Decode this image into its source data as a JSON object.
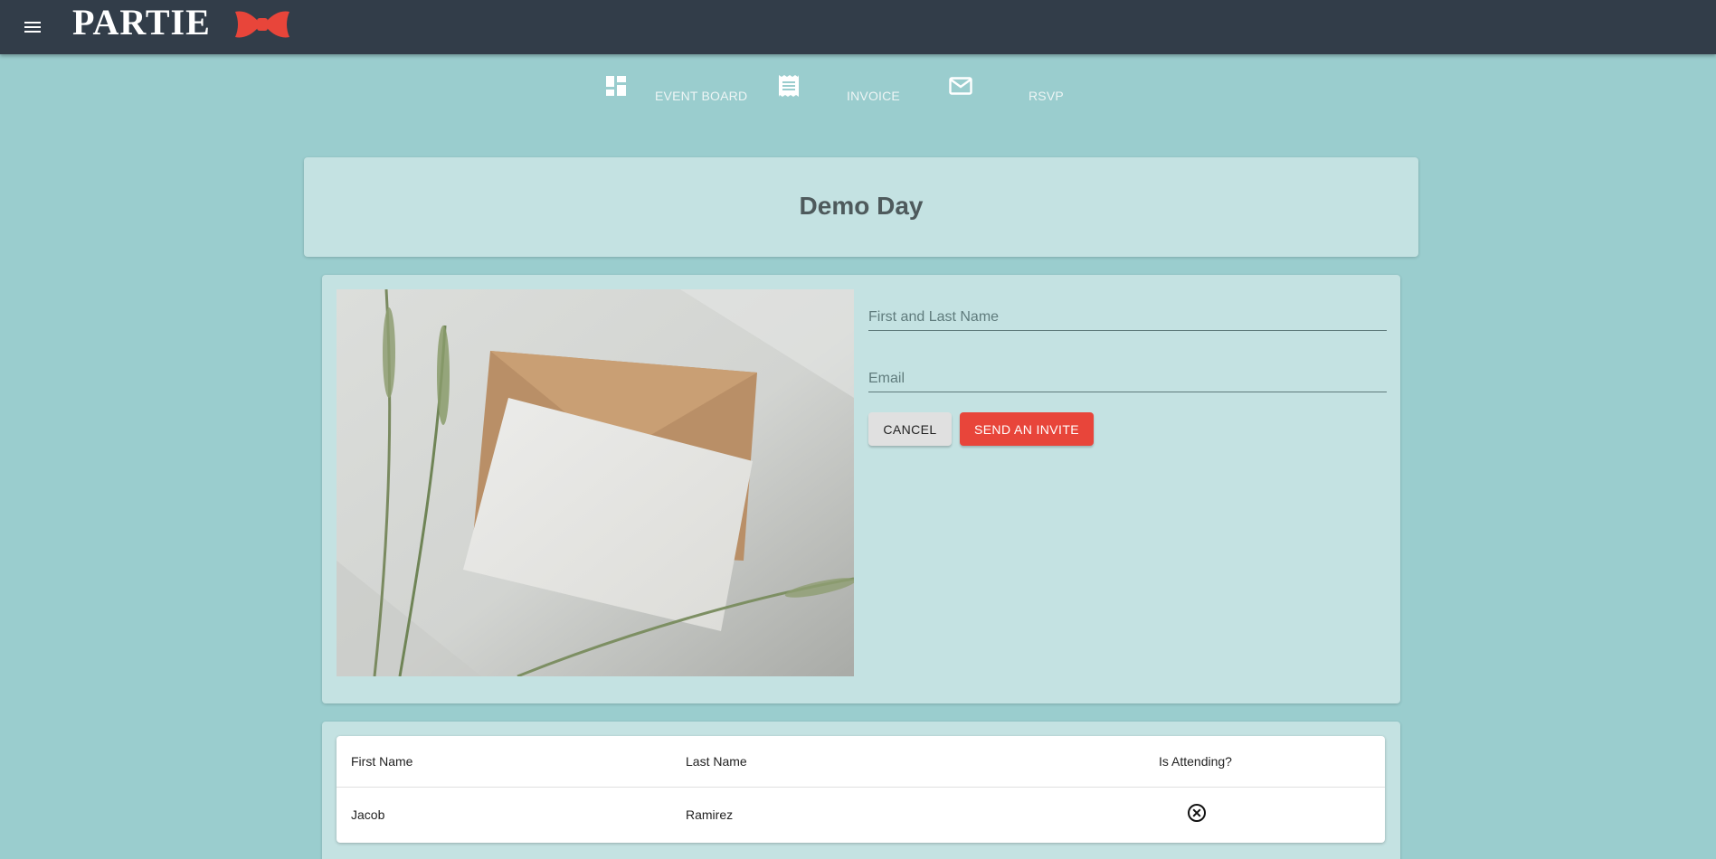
{
  "app": {
    "brand": "PARTIE",
    "brand_accent": "#e8453a",
    "appbar_color": "#323d49",
    "background_color": "#9acdce"
  },
  "nav": {
    "items": [
      {
        "label": "EVENT BOARD",
        "icon": "dashboard-icon"
      },
      {
        "label": "INVOICE",
        "icon": "receipt-icon"
      },
      {
        "label": "RSVP",
        "icon": "mail-icon"
      }
    ]
  },
  "event": {
    "title": "Demo Day"
  },
  "form": {
    "name_placeholder": "First and Last Name",
    "email_placeholder": "Email",
    "cancel_label": "CANCEL",
    "send_label": "SEND AN INVITE",
    "send_color": "#e8453a"
  },
  "guests": {
    "columns": [
      "First Name",
      "Last Name",
      "Is Attending?"
    ],
    "rows": [
      {
        "first_name": "Jacob",
        "last_name": "Ramirez",
        "attending_icon": "circle-x-icon"
      }
    ]
  }
}
